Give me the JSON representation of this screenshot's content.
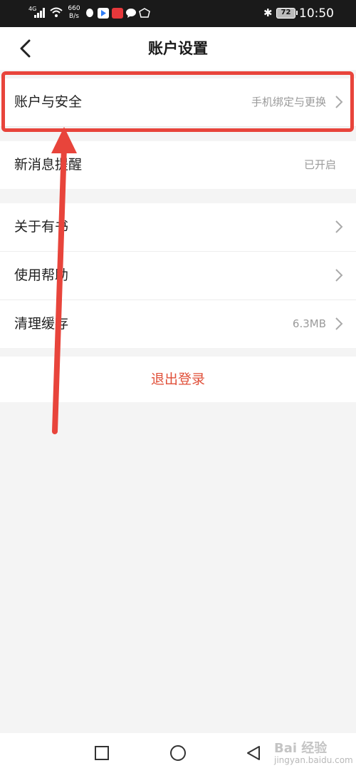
{
  "status_bar": {
    "network": "4G",
    "speed_value": "660",
    "speed_unit": "B/s",
    "battery": "72",
    "time": "10:50",
    "app_icons": [
      "qq-icon",
      "video-app-icon",
      "red-app-icon",
      "chat-icon",
      "shield-app-icon"
    ]
  },
  "header": {
    "title": "账户设置",
    "back_icon": "chevron-left-icon"
  },
  "settings": {
    "account": {
      "label": "账户与安全",
      "value": "手机绑定与更换"
    },
    "notify": {
      "label": "新消息提醒",
      "value": "已开启"
    },
    "about": {
      "label": "关于有书"
    },
    "help": {
      "label": "使用帮助"
    },
    "cache": {
      "label": "清理缓存",
      "value": "6.3MB"
    }
  },
  "logout": {
    "label": "退出登录"
  },
  "nav": {
    "icons": [
      "square-icon",
      "circle-icon",
      "triangle-back-icon"
    ]
  },
  "watermark": {
    "line1": "Bai 经验",
    "line2": "jingyan.baidu.com"
  },
  "colors": {
    "accent_red": "#e0503a",
    "annotation_red": "#e8443b",
    "status_bar": "#1a1a1a",
    "background": "#f4f4f4"
  }
}
